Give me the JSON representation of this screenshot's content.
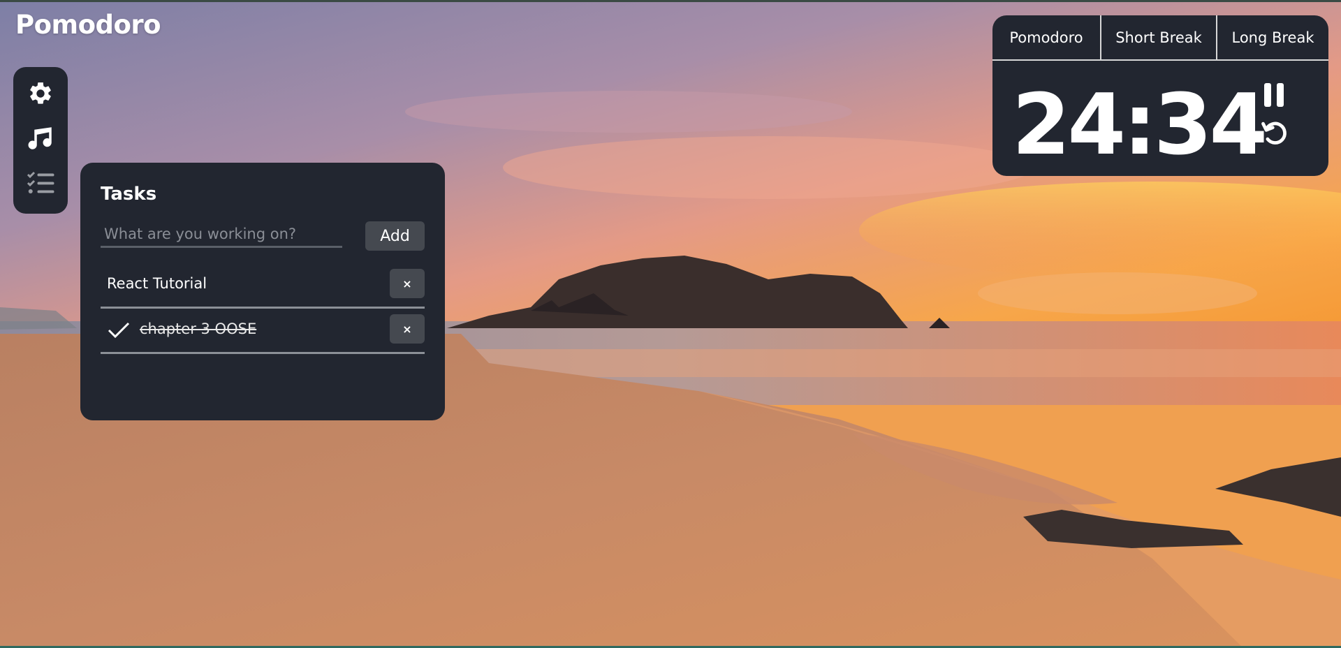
{
  "app": {
    "title": "Pomodoro"
  },
  "sidebar": {
    "items": [
      {
        "icon": "gear-icon",
        "label": "Settings"
      },
      {
        "icon": "music-note-icon",
        "label": "Music"
      },
      {
        "icon": "checklist-icon",
        "label": "Tasks"
      }
    ]
  },
  "tasks": {
    "title": "Tasks",
    "input_value": "",
    "input_placeholder": "What are you working on?",
    "add_label": "Add",
    "remove_label": "×",
    "items": [
      {
        "label": "React Tutorial",
        "done": false
      },
      {
        "label": "chapter 3 OOSE",
        "done": true
      }
    ]
  },
  "timer": {
    "tabs": [
      "Pomodoro",
      "Short Break",
      "Long Break"
    ],
    "time": "24:34",
    "controls": [
      "pause-icon",
      "restart-icon"
    ]
  },
  "colors": {
    "panel": "#222630",
    "button": "#454950",
    "text": "#ffffff"
  }
}
